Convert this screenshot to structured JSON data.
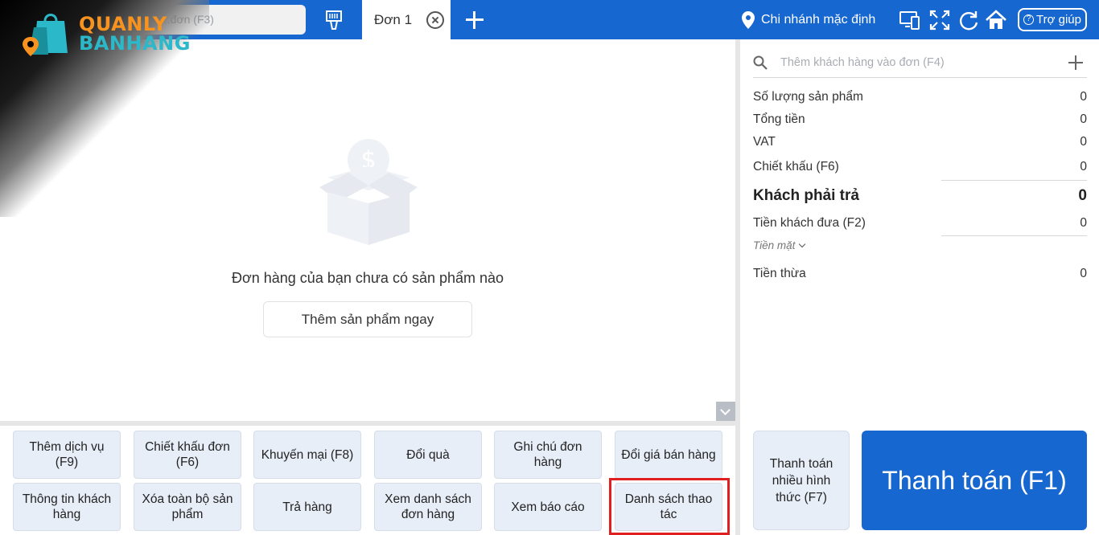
{
  "logo": {
    "line1": "QUANLY",
    "line2": "BANHANG"
  },
  "topbar": {
    "search_placeholder": "...đơn (F3)",
    "tab_label": "Đơn 1",
    "branch_label": "Chi nhánh mặc định",
    "help_label": "Trợ giúp"
  },
  "main": {
    "empty_message": "Đơn hàng của bạn chưa có sản phẩm nào",
    "add_now_label": "Thêm sản phẩm ngay"
  },
  "functions": [
    "Thêm dịch vụ (F9)",
    "Chiết khấu đơn (F6)",
    "Khuyến mại (F8)",
    "Đổi quà",
    "Ghi chú đơn hàng",
    "Đổi giá bán hàng",
    "Thông tin khách hàng",
    "Xóa toàn bộ sản phẩm",
    "Trả hàng",
    "Xem danh sách đơn hàng",
    "Xem báo cáo",
    "Danh sách thao tác"
  ],
  "summary": {
    "customer_placeholder": "Thêm khách hàng vào đơn (F4)",
    "product_count_label": "Số lượng sản phẩm",
    "product_count_value": "0",
    "total_label": "Tổng tiền",
    "total_value": "0",
    "vat_label": "VAT",
    "vat_value": "0",
    "discount_label": "Chiết khấu (F6)",
    "discount_value": "0",
    "customer_pay_label": "Khách phải trả",
    "customer_pay_value": "0",
    "customer_given_label": "Tiền khách đưa (F2)",
    "customer_given_value": "0",
    "payment_method": "Tiền mặt",
    "change_label": "Tiền thừa",
    "change_value": "0"
  },
  "payment": {
    "multi_label": "Thanh toán nhiều hình thức (F7)",
    "main_label": "Thanh toán (F1)"
  },
  "colors": {
    "primary": "#1767d0",
    "button_bg": "#e8eef8",
    "highlight": "#e02020"
  }
}
